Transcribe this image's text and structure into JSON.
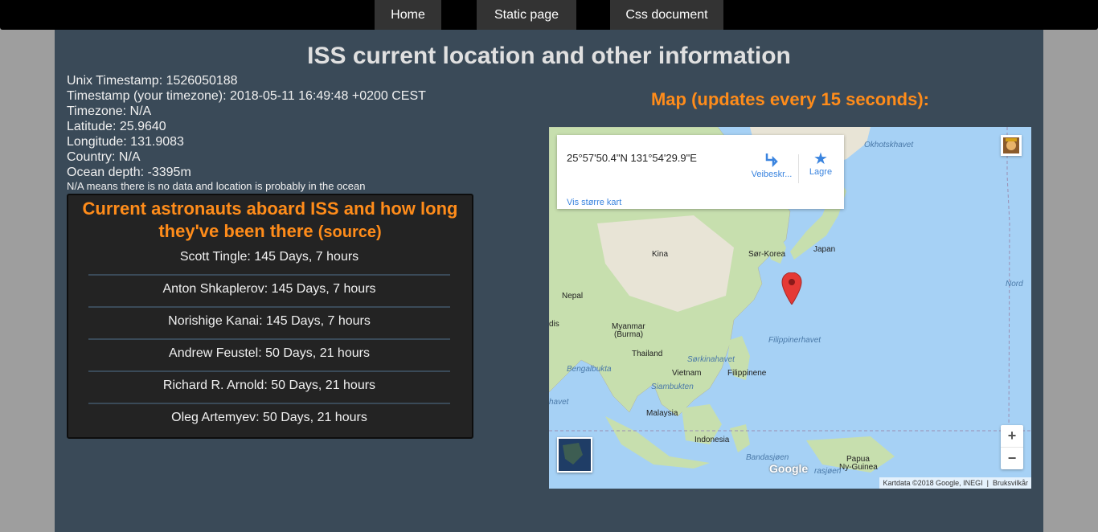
{
  "nav": {
    "home": "Home",
    "static_page": "Static page",
    "css_document": "Css document"
  },
  "title": "ISS current location and other information",
  "info": {
    "unix_timestamp": "Unix Timestamp: 1526050188",
    "timestamp": "Timestamp (your timezone): 2018-05-11 16:49:48 +0200 CEST",
    "timezone": "Timezone: N/A",
    "latitude": "Latitude: 25.9640",
    "longitude": "Longitude: 131.9083",
    "country": "Country: N/A",
    "ocean_depth": "Ocean depth: -3395m",
    "note": "N/A means there is no data and location is probably in the ocean"
  },
  "astronauts": {
    "title": "Current astronauts aboard ISS and how long they've been there",
    "source": "(source)",
    "items": [
      "Scott Tingle: 145 Days, 7 hours",
      "Anton Shkaplerov: 145 Days, 7 hours",
      "Norishige Kanai: 145 Days, 7 hours",
      "Andrew Feustel: 50 Days, 21 hours",
      "Richard R. Arnold: 50 Days, 21 hours",
      "Oleg Artemyev: 50 Days, 21 hours"
    ]
  },
  "map": {
    "title": "Map (updates every 15 seconds):",
    "coords": "25°57'50.4\"N 131°54'29.9\"E",
    "directions_label": "Veibeskr...",
    "save_label": "Lagre",
    "larger_map_link": "Vis større kart",
    "zoom_in": "+",
    "zoom_out": "−",
    "attribution": "Kartdata ©2018 Google, INEGI",
    "terms": "Bruksvilkår",
    "google_logo": "Google",
    "labels": {
      "okhotskhavet": "Okhotskhavet",
      "kina": "Kina",
      "sor_korea": "Sør-Korea",
      "japan": "Japan",
      "nord": "Nord",
      "nepal": "Nepal",
      "myanmar": "Myanmar",
      "burma": "(Burma)",
      "filippinerhavet": "Filippinerhavet",
      "thailand": "Thailand",
      "sorkinahavet": "Sørkinahavet",
      "bengalbukta": "Bengalbukta",
      "vietnam": "Vietnam",
      "filippinene": "Filippinene",
      "siambukten": "Siambukten",
      "havet": "havet",
      "malaysia": "Malaysia",
      "indonesia": "Indonesia",
      "bandasjoen": "Bandasjøen",
      "arasjoen": "rasjøen",
      "papua": "Papua",
      "ny_guinea": "Ny-Guinea",
      "dis": "dis"
    },
    "colors": {
      "water": "#a6d1f5",
      "land": "#e8e4d6",
      "land_green": "#c7dfae",
      "marker": "#e53935"
    }
  }
}
